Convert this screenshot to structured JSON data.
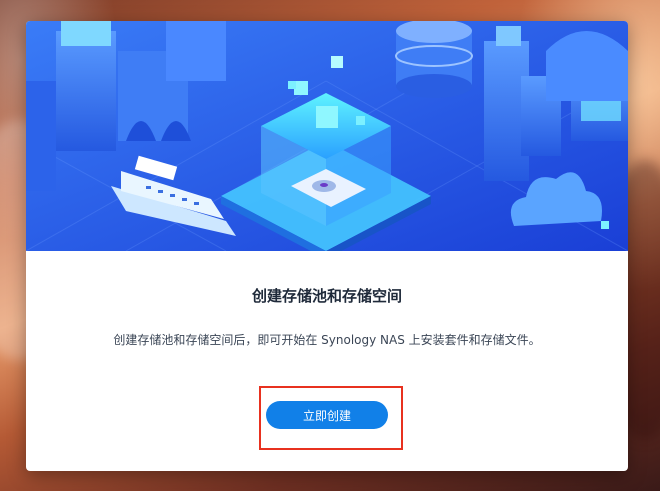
{
  "dialog": {
    "title": "创建存储池和存储空间",
    "description": "创建存储池和存储空间后，即可开始在 Synology NAS 上安装套件和存储文件。",
    "create_button_label": "立即创建"
  },
  "colors": {
    "accent": "#1180e8",
    "highlight": "#e8311f",
    "hero_blue": "#2f6ff0"
  },
  "hero": {
    "icons": [
      "city-buildings-icon",
      "cruise-ship-icon",
      "storage-box-icon",
      "hard-disk-icon",
      "database-icon",
      "cloud-icon"
    ]
  }
}
